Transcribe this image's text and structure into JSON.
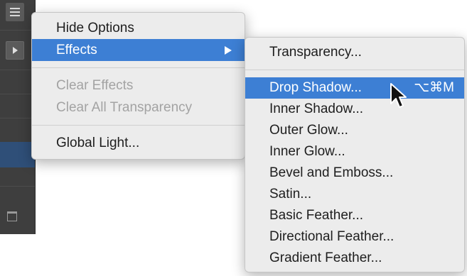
{
  "main_menu": {
    "items": [
      {
        "label": "Hide Options",
        "state": "normal"
      },
      {
        "label": "Effects",
        "state": "highlighted",
        "has_submenu": true
      },
      {
        "label": "Clear Effects",
        "state": "disabled"
      },
      {
        "label": "Clear All Transparency",
        "state": "disabled"
      },
      {
        "label": "Global Light...",
        "state": "normal"
      }
    ]
  },
  "effects_submenu": {
    "items": [
      {
        "label": "Transparency...",
        "state": "normal"
      },
      {
        "label": "Drop Shadow...",
        "state": "highlighted",
        "shortcut": "⌥⌘M"
      },
      {
        "label": "Inner Shadow...",
        "state": "normal"
      },
      {
        "label": "Outer Glow...",
        "state": "normal"
      },
      {
        "label": "Inner Glow...",
        "state": "normal"
      },
      {
        "label": "Bevel and Emboss...",
        "state": "normal"
      },
      {
        "label": "Satin...",
        "state": "normal"
      },
      {
        "label": "Basic Feather...",
        "state": "normal"
      },
      {
        "label": "Directional Feather...",
        "state": "normal"
      },
      {
        "label": "Gradient Feather...",
        "state": "normal"
      }
    ]
  },
  "icons": {
    "panel_menu": "hamburger-icon",
    "panel_expand": "play-arrow-icon",
    "submenu_indicator": "chevron-right-icon",
    "trash": "trash-icon",
    "cursor": "mouse-pointer-icon"
  },
  "colors": {
    "highlight": "#3d7fd4",
    "menu_background": "#ececec",
    "disabled_text": "#a3a3a3",
    "panel_background": "#3e3e3e"
  }
}
